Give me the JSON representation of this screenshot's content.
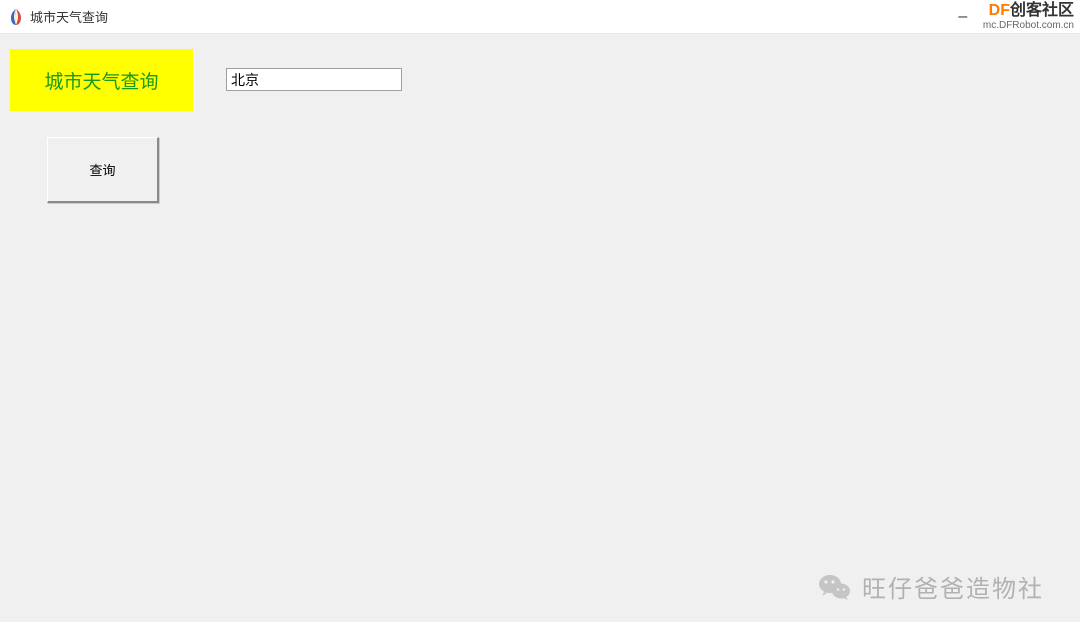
{
  "titlebar": {
    "title": "城市天气查询",
    "minimize": "–"
  },
  "watermark_top": {
    "df": "DF",
    "rest": "创客社区",
    "url": "mc.DFRobot.com.cn"
  },
  "form": {
    "header_label": "城市天气查询",
    "city_value": "北京",
    "query_button": "查询"
  },
  "watermark_bottom": {
    "text": "旺仔爸爸造物社"
  }
}
